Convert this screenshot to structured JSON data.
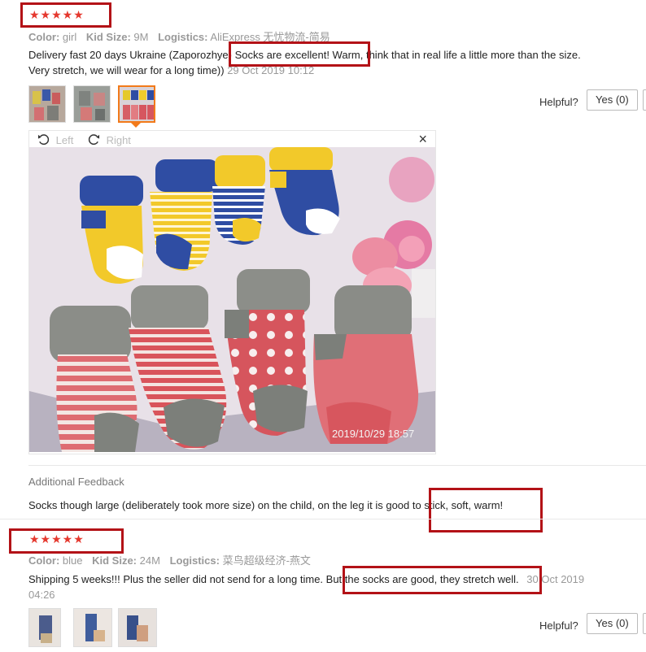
{
  "reviews": [
    {
      "stars": "★★★★★",
      "meta": {
        "color_label": "Color:",
        "color_value": "girl",
        "size_label": "Kid Size:",
        "size_value": "9M",
        "logistics_label": "Logistics:",
        "logistics_value": "AliExpress 无忧物流-简易"
      },
      "text_part1": "Delivery fast 20 days Ukraine (Zaporozhye) ",
      "text_highlight": "Socks are excellent! Warm",
      "text_part2": ", think that in real life a little more than the size.",
      "text_line2": "Very stretch, we will wear for a long time))",
      "date": "29 Oct 2019 10:12",
      "helpful_label": "Helpful?",
      "yes_label": "Yes (0)",
      "viewer": {
        "left_label": "Left",
        "right_label": "Right",
        "close_label": "×",
        "timestamp": "2019/10/29  18:57"
      },
      "additional_title": "Additional Feedback",
      "additional_part1": "Socks though large (deliberately took more size) on the child, on the leg it is good to ",
      "additional_highlight": "stick, soft, warm!"
    },
    {
      "stars": "★★★★★",
      "meta": {
        "color_label": "Color:",
        "color_value": "blue",
        "size_label": "Kid Size:",
        "size_value": "24M",
        "logistics_label": "Logistics:",
        "logistics_value": "菜鸟超级经济-燕文"
      },
      "text_part1": "Shipping 5 weeks!!! Plus the seller did not send for a long time. But ",
      "text_highlight": "the socks are good, they stretch well.",
      "date_line1": "30 Oct 2019",
      "date_line2": "04:26",
      "helpful_label": "Helpful?",
      "yes_label": "Yes (0)"
    }
  ],
  "colors": {
    "star": "#e5382e",
    "highlight_border": "#b31217",
    "selected_thumb": "#f27a1a"
  }
}
